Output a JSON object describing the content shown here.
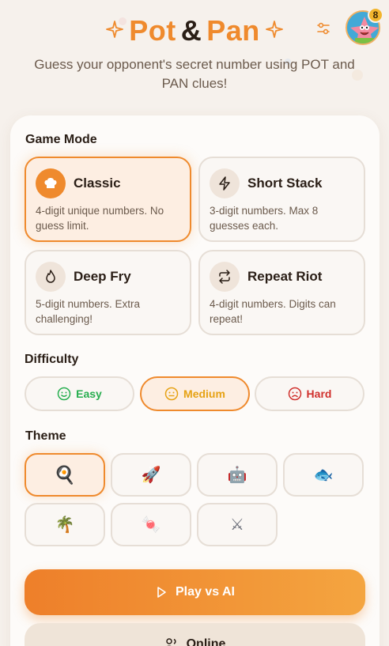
{
  "header": {
    "title_pot": "Pot",
    "title_amp": "&",
    "title_pan": "Pan",
    "subtitle": "Guess your opponent's secret number using POT and PAN clues!",
    "badge_count": "8",
    "avatar_icon": "patrick-star-avatar"
  },
  "game_mode": {
    "label": "Game Mode",
    "modes": [
      {
        "name": "Classic",
        "desc": "4-digit unique numbers. No guess limit.",
        "icon": "chef-hat-icon",
        "selected": true
      },
      {
        "name": "Short Stack",
        "desc": "3-digit numbers. Max 8 guesses each.",
        "icon": "lightning-icon",
        "selected": false
      },
      {
        "name": "Deep Fry",
        "desc": "5-digit numbers. Extra challenging!",
        "icon": "flame-icon",
        "selected": false
      },
      {
        "name": "Repeat Riot",
        "desc": "4-digit numbers. Digits can repeat!",
        "icon": "repeat-icon",
        "selected": false
      }
    ]
  },
  "difficulty": {
    "label": "Difficulty",
    "options": [
      {
        "name": "Easy",
        "color": "#27ae4f",
        "icon": "smile-face-icon",
        "selected": false
      },
      {
        "name": "Medium",
        "color": "#e6a214",
        "icon": "neutral-face-icon",
        "selected": true
      },
      {
        "name": "Hard",
        "color": "#d0312d",
        "icon": "frown-face-icon",
        "selected": false
      }
    ]
  },
  "theme": {
    "label": "Theme",
    "options": [
      {
        "icon": "frying-pan-icon",
        "glyph": "🍳",
        "selected": true
      },
      {
        "icon": "rocket-icon",
        "glyph": "🚀",
        "selected": false
      },
      {
        "icon": "robot-icon",
        "glyph": "🤖",
        "selected": false
      },
      {
        "icon": "fish-icon",
        "glyph": "🐟",
        "selected": false
      },
      {
        "icon": "palm-tree-icon",
        "glyph": "🌴",
        "selected": false
      },
      {
        "icon": "candy-icon",
        "glyph": "🍬",
        "selected": false
      },
      {
        "icon": "crossed-swords-icon",
        "glyph": "⚔",
        "selected": false
      }
    ]
  },
  "actions": {
    "play_label": "Play vs AI",
    "online_label": "Online"
  },
  "colors": {
    "accent": "#ef8a2d",
    "background": "#f6f1ec"
  }
}
